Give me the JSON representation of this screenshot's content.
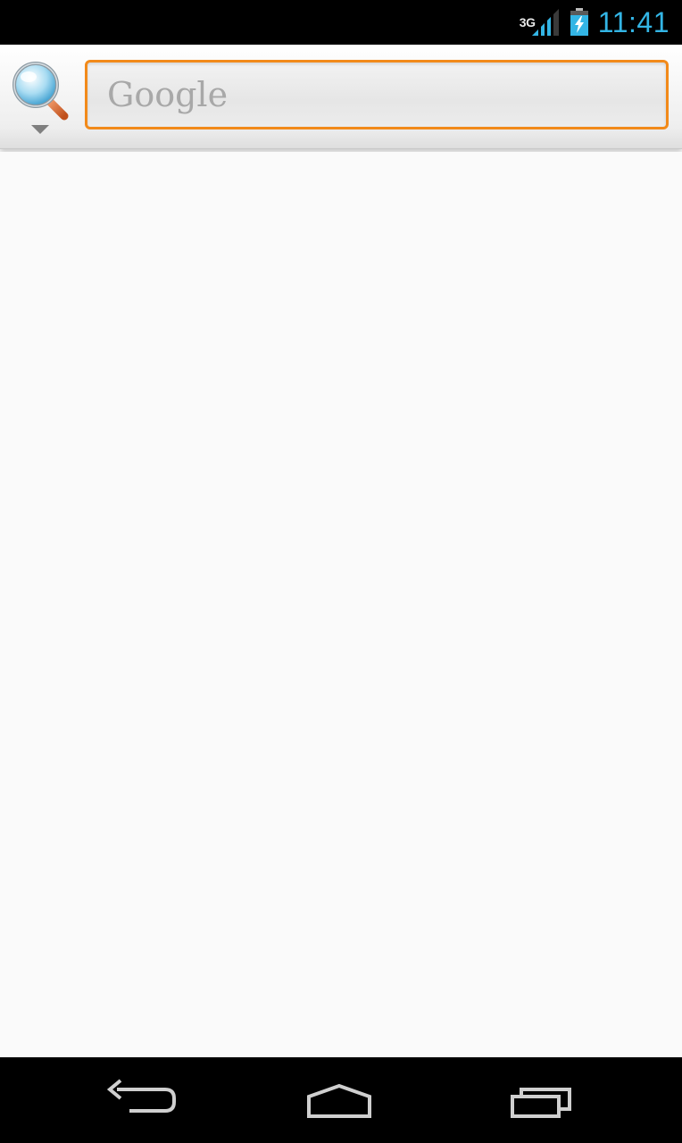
{
  "status_bar": {
    "network_type": "3G",
    "time": "11:41",
    "icons": [
      "signal-icon",
      "battery-charging-icon"
    ]
  },
  "search": {
    "placeholder": "Google",
    "value": "",
    "engine_icon": "search-icon",
    "focus_color": "#f28a1a"
  },
  "nav_bar": {
    "buttons": [
      "back-icon",
      "home-icon",
      "recent-apps-icon"
    ]
  },
  "colors": {
    "clock": "#33b5e5",
    "accent": "#f28a1a"
  }
}
